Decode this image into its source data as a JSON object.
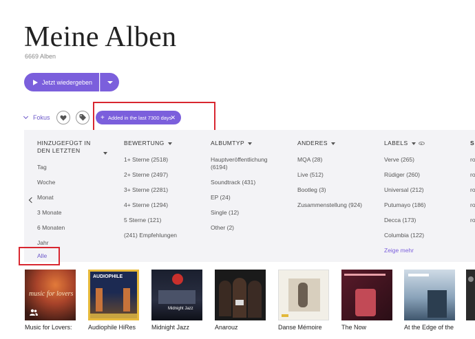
{
  "header": {
    "title": "Meine Alben",
    "subtitle": "6669 Alben"
  },
  "actions": {
    "play_label": "Jetzt wiedergeben"
  },
  "filters": {
    "focus_label": "Fokus",
    "active_chip_label": "Added in the last 7300 days"
  },
  "columns": [
    {
      "header": "HINZUGEFÜGT IN DEN LETZTEN",
      "items": [
        "Tag",
        "Woche",
        "Monat",
        "3 Monate",
        "6 Monaten",
        "Jahr",
        "Alle"
      ]
    },
    {
      "header": "BEWERTUNG",
      "items": [
        "1+ Sterne (2518)",
        "2+ Sterne (2497)",
        "3+ Sterne (2281)",
        "4+ Sterne (1294)",
        "5 Sterne (121)",
        "(241) Empfehlungen"
      ]
    },
    {
      "header": "ALBUMTYP",
      "items": [
        "Hauptveröffentlichung (6194)",
        "Soundtrack (431)",
        "EP (24)",
        "Single (12)",
        "Other (2)"
      ]
    },
    {
      "header": "ANDERES",
      "items": [
        "MQA (28)",
        "Live (512)",
        "Bootleg (3)",
        "Zusammenstellung (924)"
      ]
    },
    {
      "header": "LABELS",
      "items": [
        "Verve (265)",
        "Rüdiger (260)",
        "Universal (212)",
        "Putumayo (186)",
        "Decca (173)",
        "Columbia (122)"
      ],
      "more": "Zeige mehr"
    },
    {
      "header": "S",
      "items": [
        "ro",
        "ro",
        "ro",
        "ro",
        "ro"
      ]
    }
  ],
  "albums": [
    {
      "title": "Music for Lovers:",
      "cover_text": "music for lovers"
    },
    {
      "title": "Audiophile HiRes",
      "cover_text": "AUDIOPHILE"
    },
    {
      "title": "Midnight Jazz",
      "cover_text": "Midnight Jazz"
    },
    {
      "title": "Anarouz",
      "cover_text": ""
    },
    {
      "title": "Danse Mémoire",
      "cover_text": ""
    },
    {
      "title": "The Now",
      "cover_text": ""
    },
    {
      "title": "At the Edge of the",
      "cover_text": ""
    },
    {
      "title": "",
      "cover_text": ""
    }
  ],
  "colors": {
    "accent": "#7b5fdc",
    "highlight_box": "#d8262f",
    "panel_bg": "#f3f3f6"
  }
}
